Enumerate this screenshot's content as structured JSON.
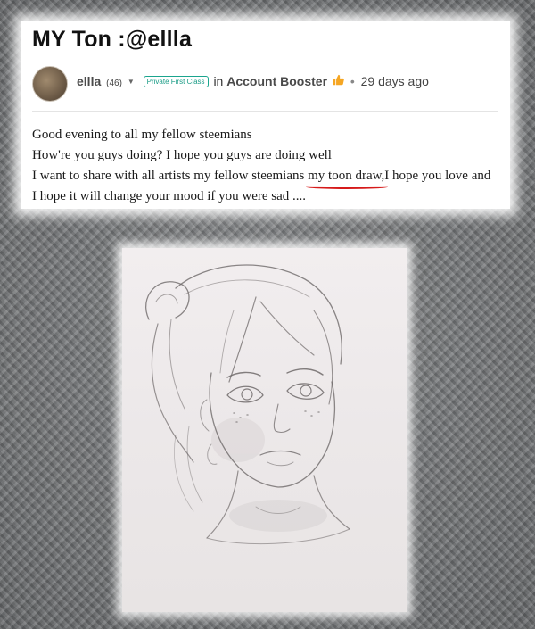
{
  "post": {
    "title": "MY Ton :@ellla",
    "author": {
      "name": "ellla",
      "reputation": "(46)",
      "rank_badge": "Private First Class"
    },
    "in_label": "in",
    "community": "Account Booster",
    "community_icon": "thumbs-up-icon",
    "separator": "•",
    "time_ago": "29 days ago",
    "body": {
      "line1": "Good evening to all my fellow steemians",
      "line2": "How're you guys doing? I hope you guys are doing well",
      "line3_before": "I want to share with all artists my fellow steemians ",
      "line3_underlined": "my toon draw,",
      "line3_after": "I hope you love and I hope it will change your mood if you were sad ...."
    }
  },
  "colors": {
    "badge": "#1aa58e",
    "underline": "#d61a1a",
    "thumb": "#f5a623"
  }
}
